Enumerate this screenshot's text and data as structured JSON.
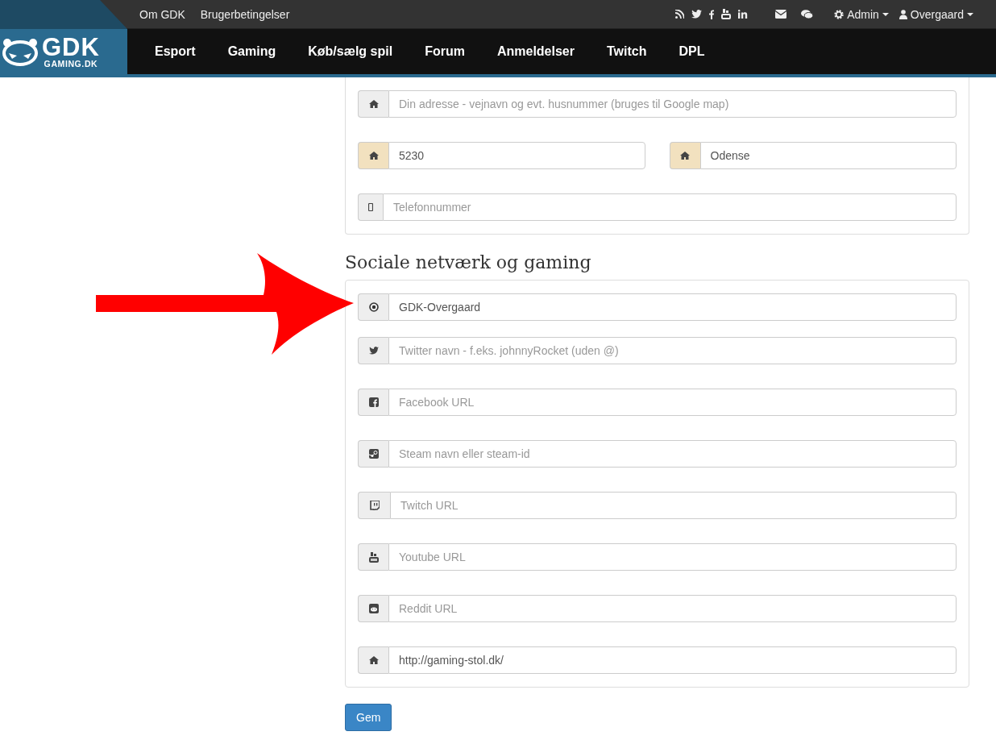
{
  "topbar": {
    "links": [
      "Om GDK",
      "Brugerbetingelser"
    ],
    "menus": [
      "Admin",
      "Overgaard"
    ]
  },
  "logo": {
    "title": "GDK",
    "subtitle": "GAMING.DK"
  },
  "nav": {
    "items": [
      "Esport",
      "Gaming",
      "Køb/sælg spil",
      "Forum",
      "Anmeldelser",
      "Twitch",
      "DPL"
    ]
  },
  "address_panel": {
    "rows": [
      [
        {
          "placeholder": "Din adresse - vejnavn og evt. husnummer (bruges til Google map)",
          "highlighted": false
        }
      ],
      [
        {
          "value": "5230",
          "highlighted": true
        },
        {
          "value": "Odense",
          "highlighted": true
        }
      ],
      [
        {
          "placeholder": "Telefonnummer",
          "highlighted": false
        }
      ]
    ]
  },
  "social_section": {
    "heading": "Sociale netværk og gaming",
    "fields": [
      {
        "value": "GDK-Overgaard",
        "highlighted": false
      },
      {
        "placeholder": "Twitter navn - f.eks. johnnyRocket (uden @)",
        "highlighted": false
      },
      {
        "placeholder": "Facebook URL",
        "highlighted": false
      },
      {
        "placeholder": "Steam navn eller steam-id",
        "highlighted": false
      },
      {
        "placeholder": "Twitch URL",
        "highlighted": false
      },
      {
        "placeholder": "Youtube URL",
        "highlighted": false
      },
      {
        "placeholder": "Reddit URL",
        "highlighted": false
      },
      {
        "value": "http://gaming-stol.dk/",
        "highlighted": false
      }
    ]
  },
  "save_button": "Gem"
}
